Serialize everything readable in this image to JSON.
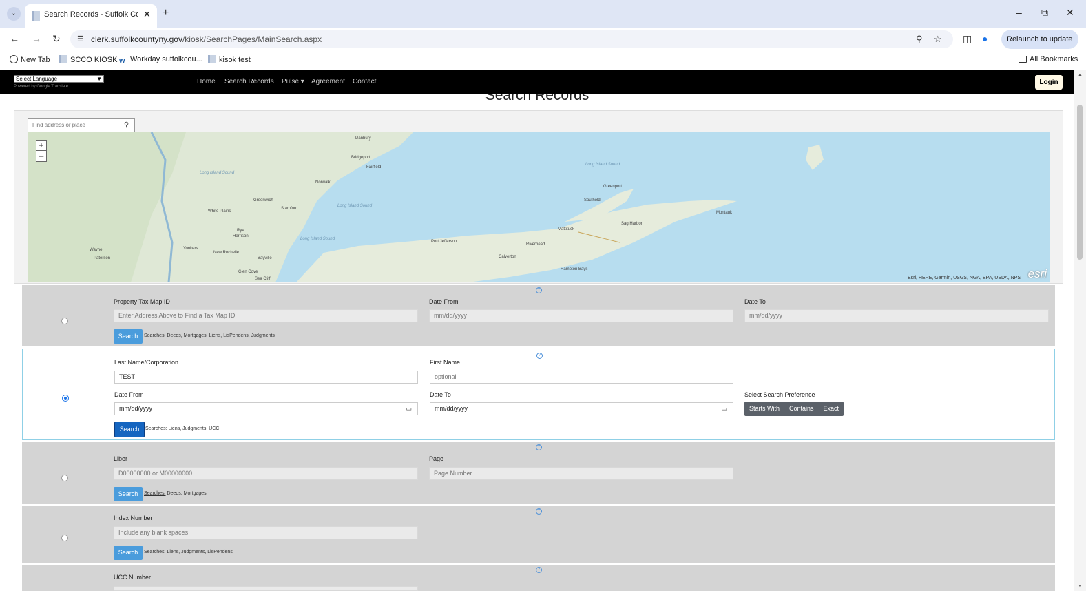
{
  "browser": {
    "tab_title": "Search Records - Suffolk County",
    "url_domain": "clerk.suffolkcountyny.gov",
    "url_path": "/kiosk/SearchPages/MainSearch.aspx",
    "relaunch_label": "Relaunch to update"
  },
  "bookmarks": {
    "items": [
      "New Tab",
      "SCCO KIOSK",
      "Workday suffolkcou...",
      "kisok test"
    ],
    "all_label": "All Bookmarks"
  },
  "site": {
    "language_select": "Select Language",
    "powered_by": "Powered by Google Translate",
    "nav": [
      "Home",
      "Search Records",
      "Pulse ▾",
      "Agreement",
      "Contact"
    ],
    "login_label": "Login",
    "page_title": "Search Records"
  },
  "map": {
    "search_placeholder": "Find address or place",
    "zoom_in": "+",
    "zoom_out": "–",
    "attribution": "Esri, HERE, Garmin, USGS, NGA, EPA, USDA, NPS",
    "logo": "esri",
    "labels": [
      "Danbury",
      "Bridgeport",
      "Fairfield",
      "Norwalk",
      "Stamford",
      "Greenwich",
      "White Plains",
      "Yonkers",
      "New Rochelle",
      "Paterson",
      "Wayne",
      "Montauk",
      "Sag Harbor",
      "Riverhead",
      "Southold",
      "Greenport",
      "Mattituck",
      "Calverton",
      "Hampton Bays",
      "Port Jefferson",
      "Glen Cove",
      "Rye",
      "Harrison",
      "Bayville",
      "Sea Cliff"
    ],
    "water_labels": [
      "Long Island Sound",
      "Long Island Sound",
      "Long Island Sound",
      "Long Island Sound"
    ]
  },
  "panels": {
    "tax": {
      "label_id": "Property Tax Map ID",
      "placeholder_id": "Enter Address Above to Find a Tax Map ID",
      "label_from": "Date From",
      "placeholder_from": "mm/dd/yyyy",
      "label_to": "Date To",
      "placeholder_to": "mm/dd/yyyy",
      "search": "Search",
      "searches_prefix": "Searches:",
      "searches_text": "Deeds, Mortgages, Liens, LisPendens, Judgments"
    },
    "name": {
      "label_last": "Last Name/Corporation",
      "value_last": "TEST",
      "label_first": "First Name",
      "placeholder_first": "optional",
      "label_from": "Date From",
      "placeholder_from": "mm/dd/yyyy",
      "label_to": "Date To",
      "placeholder_to": "mm/dd/yyyy",
      "label_pref": "Select Search Preference",
      "pref_options": [
        "Starts With",
        "Contains",
        "Exact"
      ],
      "search": "Search",
      "searches_prefix": "Searches:",
      "searches_text": "Liens, Judgments, UCC"
    },
    "liber": {
      "label_liber": "Liber",
      "placeholder_liber": "D00000000 or M00000000",
      "label_page": "Page",
      "placeholder_page": "Page Number",
      "search": "Search",
      "searches_prefix": "Searches:",
      "searches_text": "Deeds, Mortgages"
    },
    "index": {
      "label_index": "Index Number",
      "placeholder_index": "Include any blank spaces",
      "search": "Search",
      "searches_prefix": "Searches:",
      "searches_text": "Liens, Judgments, LisPendens"
    },
    "ucc": {
      "label_ucc": "UCC Number"
    }
  },
  "colors": {
    "primary_button": "#1565c0",
    "search_button": "#4a9cdc",
    "active_border": "#8fd0e6",
    "panel_bg": "#d4d4d4"
  }
}
